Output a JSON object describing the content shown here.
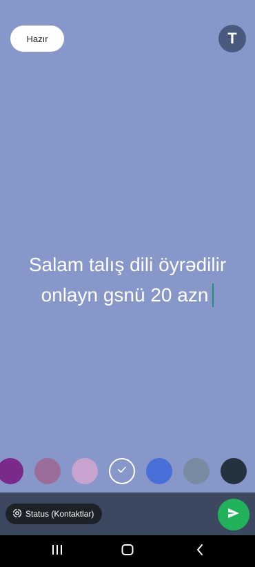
{
  "header": {
    "done_label": "Hazır",
    "font_toggle_label": "T"
  },
  "status": {
    "line1": "Salam talış dili öyrədilir",
    "line2": "onlayn gsnü 20 azn"
  },
  "palette": {
    "colors": [
      "#7a2a8a",
      "#9a6d9b",
      "#c9a3cf",
      "#8797c9",
      "#4a6fd8",
      "#7a8aa0",
      "#24323f"
    ],
    "selected_index": 3
  },
  "footer": {
    "audience_label": "Status (Kontaktlar)",
    "send_color": "#21b25b"
  },
  "icons": {
    "send": "send-arrow-icon",
    "audience": "status-ring-icon",
    "check": "check-icon",
    "recents": "recents-icon",
    "home": "home-icon",
    "back": "back-icon"
  }
}
